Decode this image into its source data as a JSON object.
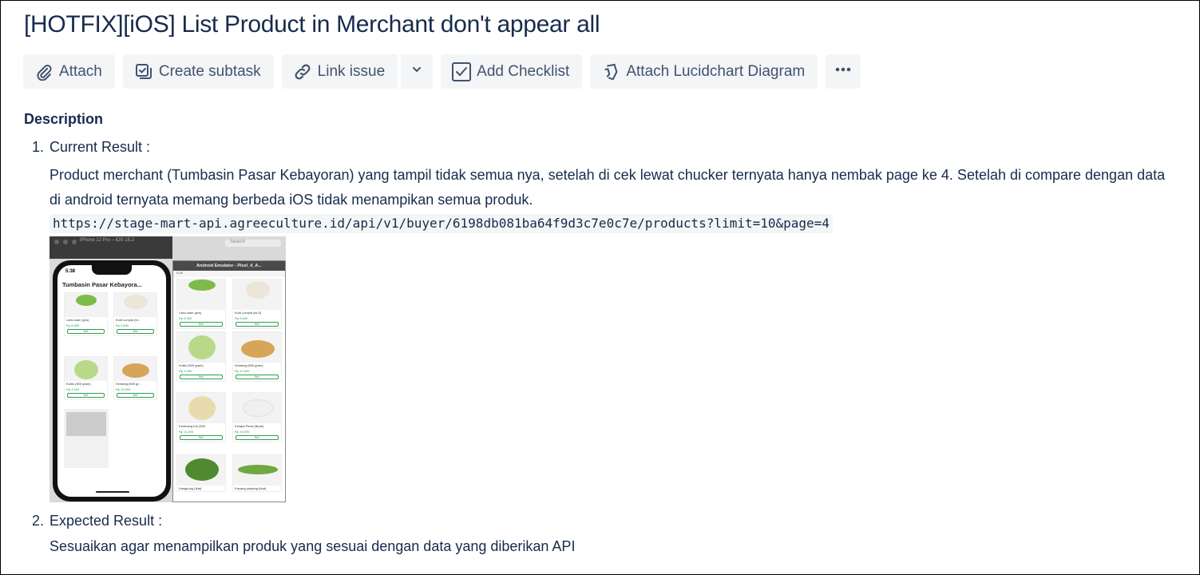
{
  "issue": {
    "title": "[HOTFIX][iOS] List Product in Merchant don't appear all"
  },
  "toolbar": {
    "attach_label": "Attach",
    "create_subtask_label": "Create subtask",
    "link_issue_label": "Link issue",
    "add_checklist_label": "Add Checklist",
    "attach_lucidchart_label": "Attach Lucidchart Diagram"
  },
  "description": {
    "heading": "Description",
    "items": [
      {
        "number": "1.",
        "label": "Current Result :",
        "text": "Product merchant (Tumbasin Pasar Kebayoran) yang tampil tidak semua nya, setelah di cek lewat chucker ternyata hanya nembak page ke 4. Setelah di compare dengan data di android ternyata memang berbeda iOS tidak menampikan semua produk.",
        "code": "https://stage-mart-api.agreeculture.id/api/v1/buyer/6198db081ba64f9d3c7e0c7e/products?limit=10&page=4"
      },
      {
        "number": "2.",
        "label": "Expected Result :",
        "text": "Sesuaikan agar menampilkan produk yang sesuai dengan data yang diberikan API"
      }
    ]
  },
  "screenshot": {
    "simulator_label": "iPhone 12 Pro – iOS 15.2",
    "search_label": "Search",
    "phone_time": "5:38",
    "phone_header": "Tumbasin Pasar Kebayora...",
    "emulator_title": "Android Emulator - Pixel_4_A...",
    "emulator_time": "5:38",
    "buy_label": "Beli",
    "ios_products": [
      {
        "name": "Labu siam (pcs)",
        "price": "Rp 8,300"
      },
      {
        "name": "Kulit Lumpia (bi...",
        "price": "Rp 5,600"
      },
      {
        "name": "Kubis (500 gram)",
        "price": "Rp 3,300"
      },
      {
        "name": "Kentang (500 gr...",
        "price": "Rp 10,500"
      }
    ],
    "android_products": [
      {
        "name": "Labu siam (pcs)",
        "price": "Rp 8,300"
      },
      {
        "name": "Kulit Lumpia (isi 8)",
        "price": "Rp 5,600"
      },
      {
        "name": "Kubis (500 gram)",
        "price": "Rp 3,300"
      },
      {
        "name": "Kentang (500 gram)",
        "price": "Rp 10,500"
      },
      {
        "name": "Kembang Kol (500",
        "price": "Rp 11,000"
      },
      {
        "name": "Kelapa Parut (Buah)",
        "price": "Rp 10,000"
      },
      {
        "name": "Kangkung (Ikat)",
        "price": ""
      },
      {
        "name": "Kacang panjang (Ikat)",
        "price": ""
      }
    ],
    "colors": {
      "accent_green": "#2e9e4f"
    }
  },
  "colors": {
    "text": "#172B4D",
    "button_bg": "#F4F5F7",
    "button_text": "#42526E"
  }
}
